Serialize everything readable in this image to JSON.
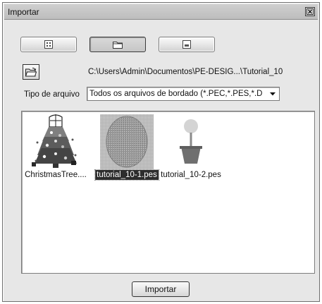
{
  "window": {
    "title": "Importar"
  },
  "view_buttons": [
    {
      "icon": "list-view-icon",
      "active": false
    },
    {
      "icon": "folder-view-icon",
      "active": true
    },
    {
      "icon": "preview-icon",
      "active": false
    }
  ],
  "location": {
    "folder_icon": "open-folder-icon",
    "path": "C:\\Users\\Admin\\Documentos\\PE-DESIG...\\Tutorial_10"
  },
  "filter": {
    "label": "Tipo de arquivo",
    "value": "Todos os arquivos de bordado (*.PEC,*.PES,*.D"
  },
  "files": [
    {
      "name": "ChristmasTree....",
      "thumbnail": "christmas-tree-embroidery",
      "selected": false
    },
    {
      "name": "tutorial_10-1.pes",
      "thumbnail": "gray-oval-embroidery",
      "selected": true
    },
    {
      "name": "tutorial_10-2.pes",
      "thumbnail": "potted-tree-embroidery",
      "selected": false
    }
  ],
  "actions": {
    "import_label": "Importar"
  },
  "colors": {
    "dialog_bg": "#e7e7e7",
    "selection_bg": "#2d2d2d",
    "selection_text": "#ffffff"
  }
}
